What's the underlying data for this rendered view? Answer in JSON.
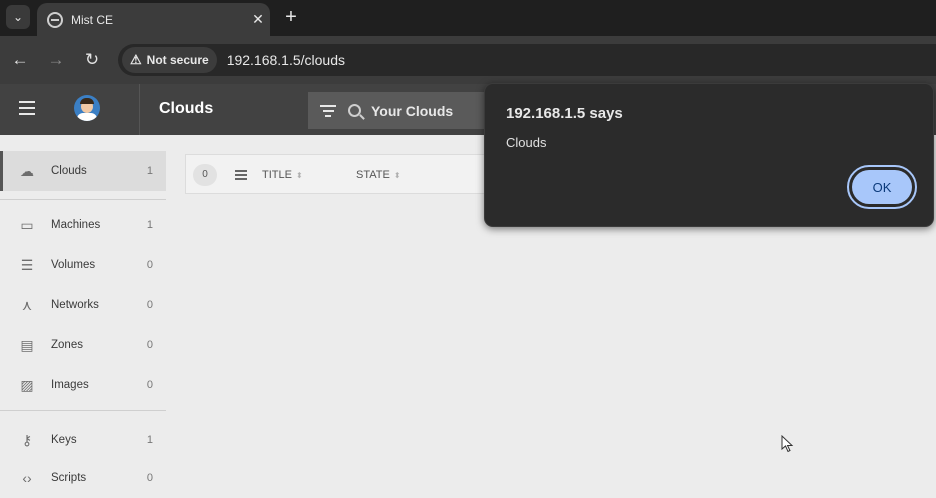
{
  "browser": {
    "tab_title": "Mist CE",
    "tab_close": "✕",
    "new_tab": "+",
    "security_label": "Not secure",
    "url": "192.168.1.5/clouds"
  },
  "header": {
    "page_title": "Clouds",
    "search_placeholder": "Your Clouds"
  },
  "sidebar": {
    "items": [
      {
        "label": "Clouds",
        "count": "1"
      },
      {
        "label": "Machines",
        "count": "1"
      },
      {
        "label": "Volumes",
        "count": "0"
      },
      {
        "label": "Networks",
        "count": "0"
      },
      {
        "label": "Zones",
        "count": "0"
      },
      {
        "label": "Images",
        "count": "0"
      },
      {
        "label": "Keys",
        "count": "1"
      },
      {
        "label": "Scripts",
        "count": "0"
      }
    ]
  },
  "table": {
    "count": "0",
    "columns": [
      "TITLE",
      "STATE"
    ]
  },
  "dialog": {
    "title": "192.168.1.5 says",
    "message": "Clouds",
    "ok_label": "OK"
  }
}
